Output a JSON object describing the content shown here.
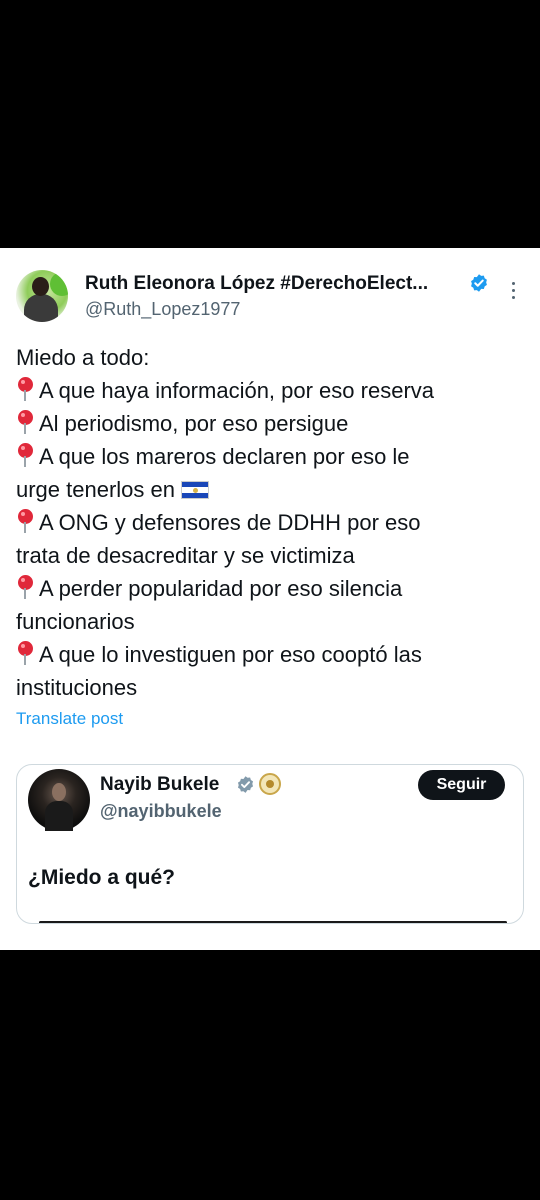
{
  "tweet": {
    "author_name": "Ruth Eleonora López #DerechoElect...",
    "author_handle": "@Ruth_Lopez1977",
    "lines": [
      "Miedo a todo:",
      "A que haya información, por eso reserva",
      "Al periodismo, por eso persigue",
      "A que los mareros declaren por eso le",
      "urge tenerlos en",
      "A ONG y defensores de DDHH por eso",
      "trata de desacreditar y se victimiza",
      "A perder popularidad por eso silencia",
      "funcionarios",
      "A que lo investiguen por eso cooptó las",
      "instituciones"
    ],
    "translate_label": "Translate post",
    "icons": {
      "bullet": "round-pushpin-icon",
      "flag": "el-salvador-flag-icon",
      "verified": "verified-badge-icon",
      "more": "more-options-icon"
    }
  },
  "quoted": {
    "author_name": "Nayib Bukele",
    "author_handle": "@nayibbukele",
    "follow_label": "Seguir",
    "text": "¿Miedo a qué?",
    "icons": {
      "verified": "gray-verified-badge-icon",
      "affiliate": "government-seal-icon"
    }
  },
  "colors": {
    "link": "#1d9bf0",
    "verified_blue": "#1d9bf0",
    "text": "#0f1419",
    "secondary": "#536471",
    "follow_bg": "#0f1419"
  }
}
